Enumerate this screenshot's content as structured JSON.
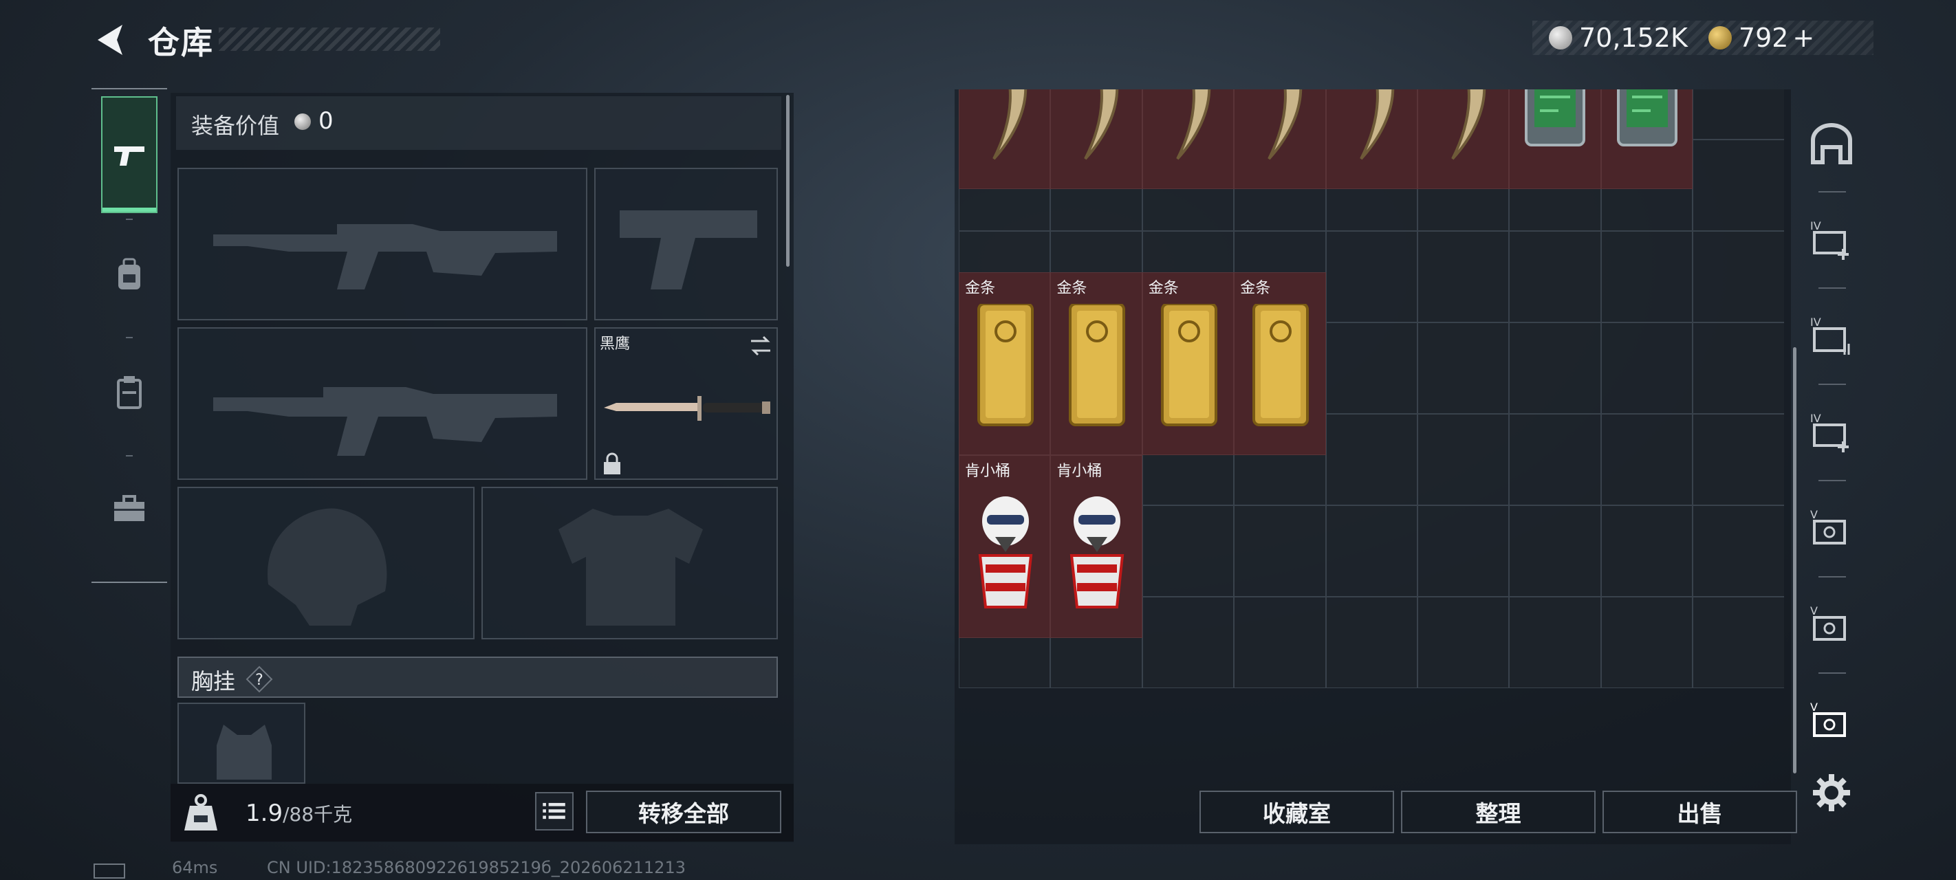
{
  "header": {
    "title": "仓库",
    "silver_amount": "70,152K",
    "gold_amount": "792",
    "gold_plus": "+"
  },
  "left_tabs": [
    {
      "name": "weapons-tab",
      "icon": "pistol-icon",
      "active": true
    },
    {
      "name": "backpack-tab",
      "icon": "backpack-icon",
      "active": false
    },
    {
      "name": "rig-tab",
      "icon": "clipboard-icon",
      "active": false
    },
    {
      "name": "kit-tab",
      "icon": "toolbox-icon",
      "active": false
    }
  ],
  "equipment": {
    "value_label": "装备价值",
    "value_amount": "0",
    "melee_name": "黑鹰",
    "chest_label": "胸挂",
    "chest_help": "?"
  },
  "weight": {
    "current": "1.9",
    "max": "/88千克"
  },
  "buttons": {
    "transfer_all": "转移全部",
    "collection_room": "收藏室",
    "organize": "整理",
    "sell": "出售"
  },
  "grid_items": [
    {
      "name": "金条",
      "count": 4
    },
    {
      "name": "肯小桶",
      "count": 2
    }
  ],
  "colors": {
    "item_bg": "#4a2529",
    "active_tab": "#5fbf8d",
    "gold": "#c9a13a"
  },
  "footer": {
    "ping": "64ms",
    "uid": "CN UID:18235868092261985219б_202606211213"
  }
}
